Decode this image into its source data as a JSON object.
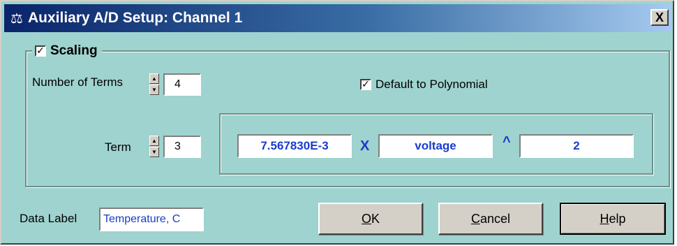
{
  "window": {
    "title": "Auxiliary A/D Setup: Channel 1",
    "app_icon": "instrument-icon",
    "close_glyph": "X"
  },
  "scaling": {
    "label": "Scaling",
    "checked": true,
    "number_of_terms": {
      "label": "Number of Terms",
      "value": "4"
    },
    "default_polynomial": {
      "label": "Default to Polynomial",
      "checked": true
    },
    "term": {
      "label": "Term",
      "value": "3"
    },
    "expression": {
      "coefficient": "7.567830E-3",
      "times_symbol": "X",
      "variable": "voltage",
      "power_symbol": "^",
      "exponent": "2"
    }
  },
  "data_label": {
    "label": "Data Label",
    "value": "Temperature, C"
  },
  "buttons": {
    "ok": {
      "mnemonic": "O",
      "rest": "K"
    },
    "cancel": {
      "mnemonic": "C",
      "rest": "ancel"
    },
    "help": {
      "mnemonic": "H",
      "rest": "elp"
    }
  },
  "colors": {
    "dialog_bg": "#9fd3cf",
    "title_bar": "#0a246a",
    "value_text": "#1a3ccc"
  }
}
